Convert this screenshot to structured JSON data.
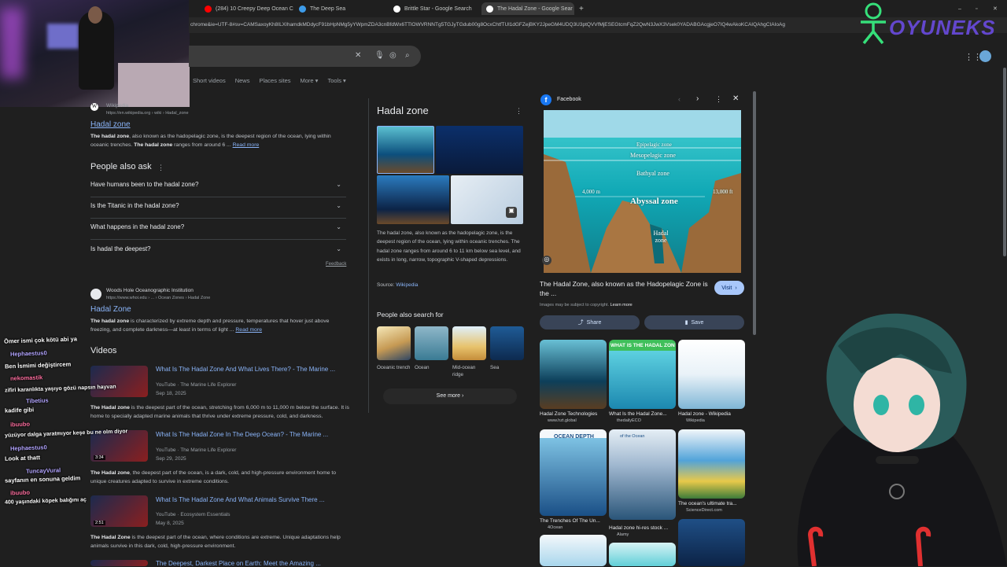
{
  "tabs": [
    {
      "label": "(284) 10 Creepy Deep Ocean C",
      "fav": "#ff0000"
    },
    {
      "label": "The Deep Sea",
      "fav": "#3d9be9"
    },
    {
      "label": "Brittle Star - Google Search",
      "fav": "#ffffff"
    },
    {
      "label": "The Hadal Zone - Google Sear",
      "fav": "#ffffff"
    }
  ],
  "url": "chrome&ie=UTF-8#sv=CAMSaxoyKh8ILXIhamdkMDdycF91bHpNMg5yYWpmZDA3cnBfdWx6TTlOWVRNNTg5TGJyTGdub00g8OcxChtfTUl1dGFZejBKY2JpeGM4UDQ3U3ptQVVfMjESEGtcmFqZ2QwN3JwX3Vsek0YADABGAcgjeO7IQ4wAkoKCAIQAhgCIAIoAg",
  "filters": [
    "Short videos",
    "News",
    "Places sites",
    "More",
    "Tools"
  ],
  "wiki_result": {
    "site": "Wikipedia",
    "url": "https://en.wikipedia.org › wiki › Hadal_zone",
    "title": "Hadal zone",
    "snippet_bold": "The hadal zone",
    "snippet": ", also known as the hadopelagic zone, is the deepest region of the ocean, lying within oceanic trenches.",
    "snippet2_bold": "The hadal zone",
    "snippet2": " ranges from around 6 ...",
    "read_more": "Read more"
  },
  "paa": {
    "heading": "People also ask",
    "questions": [
      "Have humans been to the hadal zone?",
      "Is the Titanic in the hadal zone?",
      "What happens in the hadal zone?",
      "Is hadal the deepest?"
    ],
    "feedback": "Feedback"
  },
  "whoi_result": {
    "site": "Woods Hole Oceanographic Institution",
    "url": "https://www.whoi.edu › ... › Ocean Zones › Hadal Zone",
    "title": "Hadal Zone",
    "snippet_bold": "The hadal zone",
    "snippet": " is characterized by extreme depth and pressure, temperatures that hover just above freezing, and complete darkness—at least in terms of light ...",
    "read_more": "Read more"
  },
  "videos": {
    "heading": "Videos",
    "items": [
      {
        "title": "What Is The Hadal Zone And What Lives There? - The Marine ...",
        "channel": "YouTube · The Marine Life Explorer",
        "date": "Sep 18, 2025",
        "snippet_bold": "The Hadal zone",
        "snippet": " is the deepest part of the ocean, stretching from 6,000 m to 11,000 m below the surface. It is home to specially adapted marine animals that thrive under extreme pressure, cold, and darkness.",
        "dur": ""
      },
      {
        "title": "What Is The Hadal Zone In The Deep Ocean? - The Marine ...",
        "channel": "YouTube · The Marine Life Explorer",
        "date": "Sep 29, 2025",
        "snippet_bold": "The Hadal zone",
        "snippet": ", the deepest part of the ocean, is a dark, cold, and high-pressure environment home to unique creatures adapted to survive in extreme conditions.",
        "dur": "3:34"
      },
      {
        "title": "What Is The Hadal Zone And What Animals Survive There ...",
        "channel": "YouTube · Ecosystem Essentials",
        "date": "May 8, 2025",
        "snippet_bold": "The Hadal Zone",
        "snippet": " is the deepest part of the ocean, where conditions are extreme. Unique adaptations help animals survive in this dark, cold, high-pressure environment.",
        "dur": "2:51"
      },
      {
        "title": "The Deepest, Darkest Place on Earth: Meet the Amazing ...",
        "channel": "",
        "date": "",
        "snippet_bold": "",
        "snippet": "",
        "dur": ""
      }
    ]
  },
  "chat": [
    {
      "name": "Ömer",
      "text": "Ömer ismi çok kötü abi ya",
      "pink": false
    },
    {
      "name": "Hephaestus0",
      "text": "Ben İsmimi değiştircem",
      "pink": false
    },
    {
      "name": "nekomastik",
      "text": "zifiri karanlıkta yaşıyo gözü napsın hayvan",
      "pink": true
    },
    {
      "name": "Tibetius",
      "text": "kadife gibi",
      "pink": false
    },
    {
      "name": "ibuubo",
      "text": "yüzüyor dalga yaratmıyor keşe bu ne olm diyor",
      "pink": true
    },
    {
      "name": "Hephaestus0",
      "text": "Look at thatt",
      "pink": false
    },
    {
      "name": "TuncayVural",
      "text": "sayfanın en sonuna geldim",
      "pink": false
    },
    {
      "name": "ibuubo",
      "text": "400 yaşındaki köpek balığını aç",
      "pink": true
    }
  ],
  "kp": {
    "title": "Hadal zone",
    "description": "The hadal zone, also known as the hadopelagic zone, is the deepest region of the ocean, lying within oceanic trenches. The hadal zone ranges from around 6 to 11 km below sea level, and exists in long, narrow, topographic V-shaped depressions.",
    "source_label": "Source:",
    "source": "Wikipedia",
    "pasf_heading": "People also search for",
    "pasf": [
      "Oceanic trench",
      "Ocean",
      "Mid-ocean ridge",
      "Sea"
    ],
    "see_more": "See more"
  },
  "viewer": {
    "source": "Facebook",
    "zones": {
      "epi": "Epipelagic zone",
      "meso": "Mesopelagic zone",
      "bathy": "Bathyal zone",
      "abyss": "Abyssal zone",
      "hadal": "Hadal zone",
      "left_depth": "4,000 m",
      "right_depth": "13,000 ft"
    },
    "caption": "The Hadal Zone, also known as the Hadopelagic Zone is the ...",
    "visit": "Visit",
    "copyright": "Images may be subject to copyright.",
    "learn_more": "Learn more",
    "share": "Share",
    "save": "Save",
    "related": [
      {
        "cap": "Hadal Zone Technologies",
        "src": "www.hzt.global"
      },
      {
        "cap": "What Is the Hadal Zone...",
        "src": "thedailyECO"
      },
      {
        "cap": "Hadal zone - Wikipedia",
        "src": "Wikipedia"
      },
      {
        "cap": "The Trenches Of The Un...",
        "src": "4Ocean"
      },
      {
        "cap": "Hadal zone hi-res stock ...",
        "src": "Alamy"
      },
      {
        "cap": "The ocean's ultimate tra...",
        "src": "ScienceDirect.com"
      }
    ],
    "thumb_text_1": "WHAT IS THE HADAL ZON",
    "thumb_text_2": "OCEAN DEPTH",
    "thumb_text_3": "of the Ocean"
  },
  "logo": {
    "text": "OYUNEKS"
  }
}
